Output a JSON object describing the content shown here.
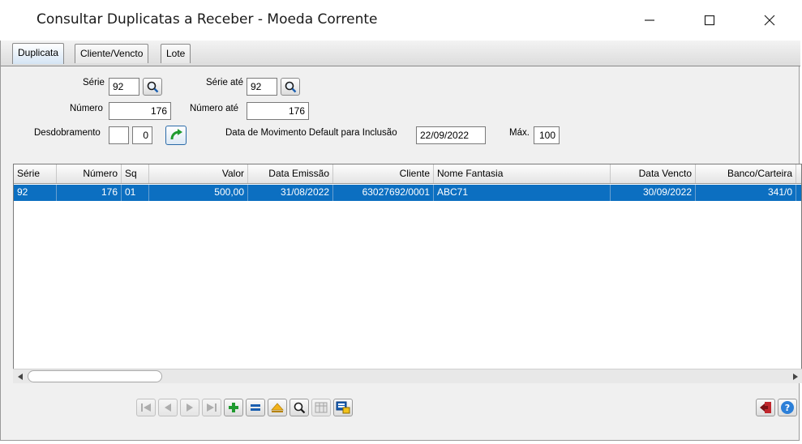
{
  "window": {
    "title": "Consultar Duplicatas a Receber - Moeda Corrente",
    "minimize_glyph": "—",
    "maximize_glyph": "☐",
    "close_glyph": "✕"
  },
  "tabs": [
    {
      "label": "Duplicata",
      "active": true
    },
    {
      "label": "Cliente/Vencto",
      "active": false
    },
    {
      "label": "Lote",
      "active": false
    }
  ],
  "form": {
    "serie_label": "Série",
    "serie_value": "92",
    "serie_ate_label": "Série até",
    "serie_ate_value": "92",
    "numero_label": "Número",
    "numero_value": "176",
    "numero_ate_label": "Número até",
    "numero_ate_value": "176",
    "desdobramento_label": "Desdobramento",
    "desdobramento_value_1": "",
    "desdobramento_value_2": "0",
    "data_mov_label": "Data de Movimento Default para Inclusão",
    "data_mov_value": "22/09/2022",
    "max_label": "Máx.",
    "max_value": "100"
  },
  "grid": {
    "columns": [
      "Série",
      "Número",
      "Sq",
      "Valor",
      "Data Emissão",
      "Cliente",
      "Nome Fantasia",
      "Data Vencto",
      "Banco/Carteira"
    ],
    "rows": [
      [
        "92",
        "176",
        "01",
        "500,00",
        "31/08/2022",
        "63027692/0001",
        "ABC71",
        "30/09/2022",
        "341/0"
      ]
    ],
    "selected_row": 0
  },
  "colors": {
    "selection": "#0c6fc1",
    "accent_green": "#1f9a2f",
    "accent_blue": "#1b5fb0",
    "exit_red": "#c0262c",
    "help_blue": "#2c7fd8"
  },
  "icons": [
    "search-icon",
    "refresh-arrow-icon",
    "first-record-icon",
    "previous-record-icon",
    "next-record-icon",
    "last-record-icon",
    "add-icon",
    "equal-icon",
    "eject-icon",
    "magnifier-icon",
    "grid-icon",
    "export-icon",
    "exit-icon",
    "help-icon"
  ]
}
